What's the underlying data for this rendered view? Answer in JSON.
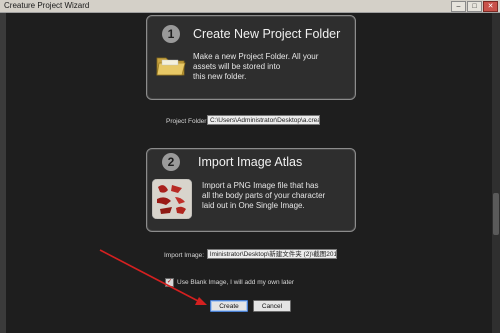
{
  "window": {
    "title": "Creature Project Wizard",
    "minimize_icon": "minimize-icon",
    "maximize_icon": "maximize-icon",
    "close_icon": "close-icon"
  },
  "step1": {
    "number": "1",
    "title": "Create New Project Folder",
    "description": [
      "Make a new Project Folder. All your",
      "assets will be stored into",
      "this new folder."
    ],
    "icon": "folder-icon"
  },
  "project_folder": {
    "label": "Project Folder:",
    "value": "C:\\Users\\Administrator\\Desktop\\a.creaProj"
  },
  "step2": {
    "number": "2",
    "title": "Import Image Atlas",
    "description": [
      "Import a PNG Image file that has",
      "all the body parts of your character",
      "laid out in One Single Image."
    ],
    "icon": "image-atlas-icon"
  },
  "import_image": {
    "label": "Import Image:",
    "value": "lministrator\\Desktop\\新建文件夹 (2)\\截图20180531"
  },
  "blank_image": {
    "label": "Use Blank Image, I will add my own later",
    "checked": true
  },
  "buttons": {
    "create": "Create",
    "cancel": "Cancel"
  },
  "colors": {
    "background": "#1e1e1e",
    "card_border": "#8c8c8c",
    "arrow": "#d42020"
  }
}
